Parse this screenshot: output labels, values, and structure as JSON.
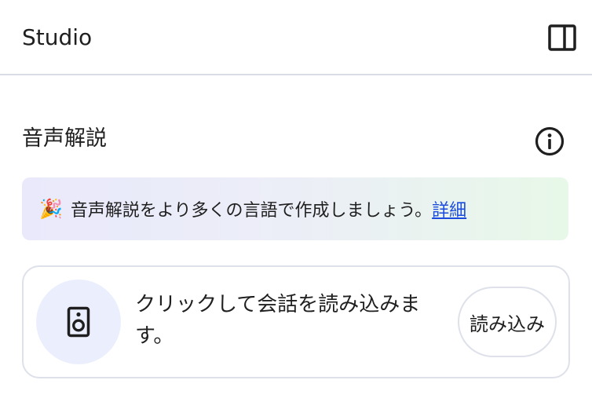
{
  "header": {
    "title": "Studio",
    "panel_toggle_icon": "side-panel-icon"
  },
  "audio_overview": {
    "title": "音声解説",
    "info_icon": "info-icon"
  },
  "banner": {
    "emoji": "🎉",
    "text": "音声解説をより多くの言語で作成しましょう。",
    "link_label": "詳細"
  },
  "card": {
    "icon": "speaker-icon",
    "text": "クリックして会話を読み込みます。",
    "button_label": "読み込み"
  },
  "colors": {
    "link": "#1a4bdc",
    "speaker_bg": "#ebeffd",
    "banner_start": "#e9e9fb",
    "banner_end": "#e7f8e8",
    "border": "#dfe1ea"
  }
}
